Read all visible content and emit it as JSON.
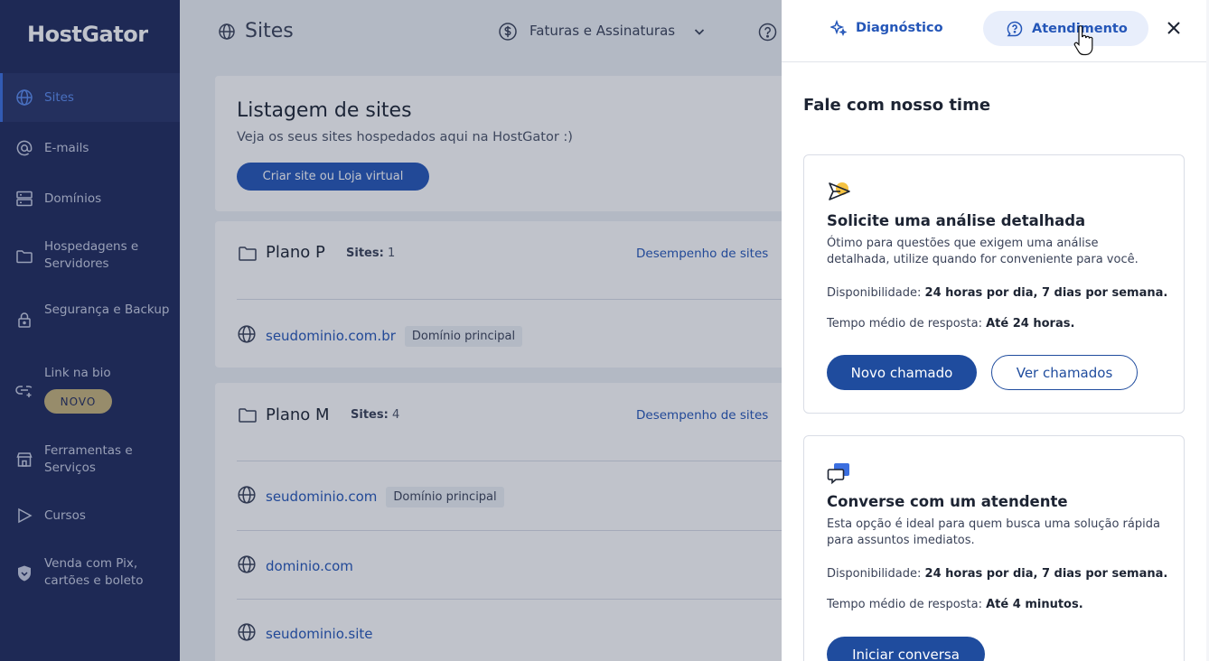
{
  "sidebar": {
    "logo": "HostGator",
    "items": [
      {
        "label": "Sites",
        "icon": "globe-icon"
      },
      {
        "label": "E-mails",
        "icon": "at-icon"
      },
      {
        "label": "Domínios",
        "icon": "server-icon"
      },
      {
        "label": "Hospedagens e Servidores",
        "icon": "folder-icon"
      },
      {
        "label": "Segurança e Backup",
        "icon": "lock-icon"
      },
      {
        "label": "Link na bio",
        "icon": "link-icon",
        "badge": "NOVO"
      },
      {
        "label": "Ferramentas e Serviços",
        "icon": "store-icon"
      },
      {
        "label": "Cursos",
        "icon": "play-icon"
      },
      {
        "label": "Venda com Pix, cartões e boleto",
        "icon": "shield-icon"
      }
    ]
  },
  "header": {
    "title": "Sites",
    "billing_label": "Faturas e Assinaturas"
  },
  "listing": {
    "title": "Listagem de sites",
    "subtitle": "Veja os seus sites hospedados aqui na HostGator :)",
    "create_button": "Criar site ou Loja virtual"
  },
  "plans": [
    {
      "name": "Plano P",
      "sites_label": "Sites:",
      "sites_count": "1",
      "performance_link": "Desempenho de sites",
      "sites": [
        {
          "domain": "seudominio.com.br",
          "tag": "Domínio principal"
        }
      ]
    },
    {
      "name": "Plano M",
      "sites_label": "Sites:",
      "sites_count": "4",
      "performance_link": "Desempenho de sites",
      "sites": [
        {
          "domain": "seudominio.com",
          "tag": "Domínio principal"
        },
        {
          "domain": "dominio.com",
          "tag": ""
        },
        {
          "domain": "seudominio.site",
          "tag": ""
        }
      ]
    }
  ],
  "panel": {
    "tab_diagnostic": "Diagnóstico",
    "tab_support": "Atendimento",
    "title": "Fale com nosso time",
    "options": [
      {
        "title": "Solicite uma análise detalhada",
        "description": "Ótimo para questões que exigem uma análise detalhada, utilize quando for conveniente para você.",
        "availability_label": "Disponibilidade:",
        "availability_value": "24 horas por dia, 7 dias por semana.",
        "response_label": "Tempo médio de resposta:",
        "response_value": "Até 24 horas.",
        "primary_button": "Novo chamado",
        "secondary_button": "Ver chamados"
      },
      {
        "title": "Converse com um atendente",
        "description": "Esta opção é ideal para quem busca uma solução rápida para assuntos imediatos.",
        "availability_label": "Disponibilidade:",
        "availability_value": "24 horas por dia, 7 dias por semana.",
        "response_label": "Tempo médio de resposta:",
        "response_value": "Até 4 minutos.",
        "primary_button": "Iniciar conversa"
      }
    ]
  },
  "colors": {
    "sidebar_bg": "#1f2a5c",
    "accent": "#2456b8",
    "primary_button": "#1f4c9e",
    "badge_gold": "#c6b37a"
  }
}
